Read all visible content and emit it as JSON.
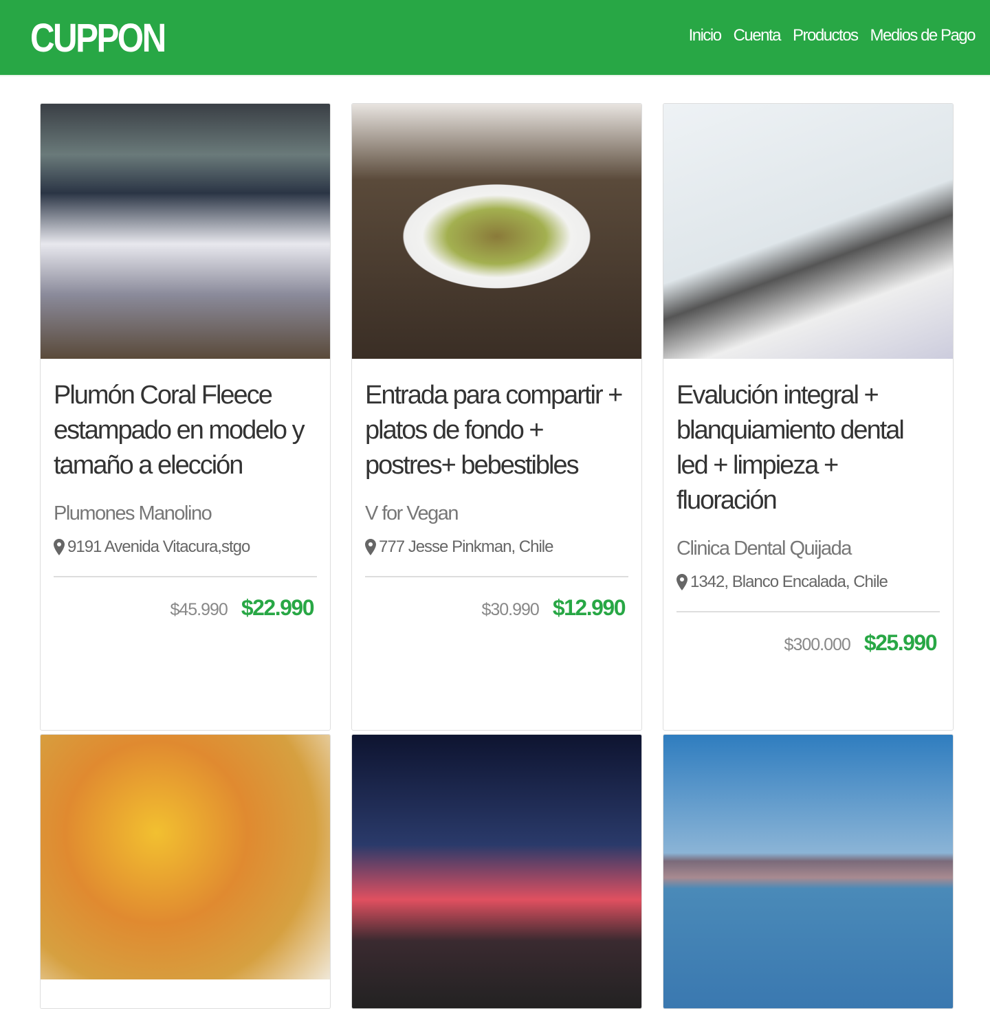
{
  "nav": {
    "logo": "CUPPON",
    "links": [
      "Inicio",
      "Cuenta",
      "Productos",
      "Medios de Pago"
    ]
  },
  "colors": {
    "brand": "#28a745"
  },
  "cards": [
    {
      "title": "Plumón Coral Fleece estampado en modelo y tamaño a elección",
      "store": "Plumones Manolino",
      "address": "9191 Avenida Vitacura,stgo",
      "old_price": "$45.990",
      "price": "$22.990"
    },
    {
      "title": "Entrada para compartir + platos de fondo + postres+ bebestibles",
      "store": "V for Vegan",
      "address": "777 Jesse Pinkman, Chile",
      "old_price": "$30.990",
      "price": "$12.990"
    },
    {
      "title": "Evalución integral + blanquiamiento dental led + limpieza + fluoración",
      "store": "Clinica Dental Quijada",
      "address": "1342, Blanco Encalada, Chile",
      "old_price": "$300.000",
      "price": "$25.990"
    }
  ]
}
